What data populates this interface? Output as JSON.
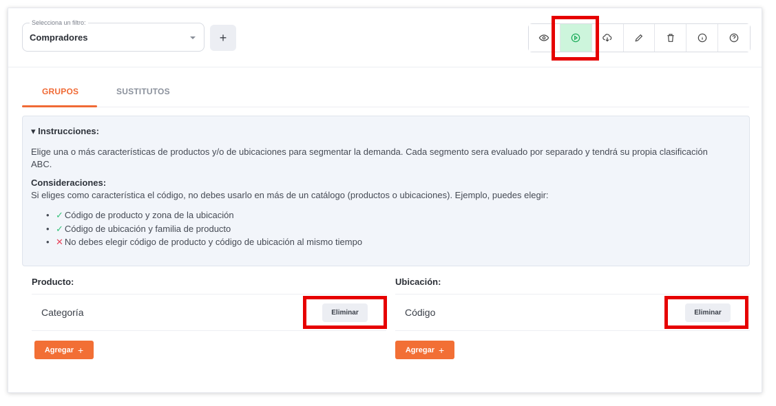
{
  "filter": {
    "legend": "Selecciona un filtro:",
    "value": "Compradores",
    "add_label": "+"
  },
  "toolbar": {
    "buttons": [
      "view-icon",
      "play-icon",
      "cloud-upload-icon",
      "pencil-icon",
      "trash-icon",
      "info-icon",
      "help-icon"
    ],
    "active": "play-icon"
  },
  "tabs": [
    {
      "label": "GRUPOS",
      "active": true
    },
    {
      "label": "SUSTITUTOS",
      "active": false
    }
  ],
  "instructions": {
    "title": "▾ Instrucciones:",
    "paragraph": "Elige una o más características de productos y/o de ubicaciones para segmentar la demanda. Cada segmento sera evaluado por separado y tendrá su propia clasificación ABC.",
    "considerations_title": "Consideraciones:",
    "considerations_text": "Si eliges como característica el código, no debes usarlo en más de un catálogo (productos o ubicaciones). Ejemplo, puedes elegir:",
    "items": [
      {
        "mark": "✓",
        "text": "Código de producto y zona de la ubicación"
      },
      {
        "mark": "✓",
        "text": "Código de ubicación y familia de producto"
      },
      {
        "mark": "✕",
        "text": "No debes elegir código de producto y código de ubicación al mismo tiempo"
      }
    ]
  },
  "product": {
    "title": "Producto:",
    "row_label": "Categoría",
    "delete_label": "Eliminar",
    "add_label": "Agregar",
    "add_icon": "+"
  },
  "location": {
    "title": "Ubicación:",
    "row_label": "Código",
    "delete_label": "Eliminar",
    "add_label": "Agregar",
    "add_icon": "+"
  },
  "colors": {
    "accent": "#f26f35",
    "highlight": "#e60000",
    "active_button": "#cdf5dc",
    "ok": "#34c27a",
    "error": "#e8425a"
  }
}
